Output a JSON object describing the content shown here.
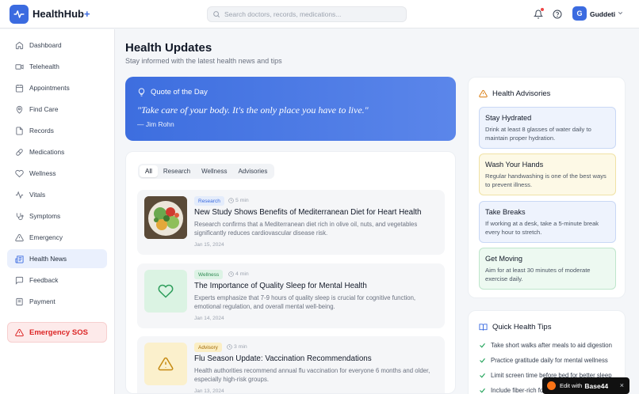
{
  "app": {
    "name": "HealthHub",
    "name_suffix": "+"
  },
  "search": {
    "placeholder": "Search doctors, records, medications..."
  },
  "user": {
    "initial": "G",
    "name": "Guddeti"
  },
  "sidebar": {
    "items": [
      {
        "label": "Dashboard",
        "icon": "home-icon"
      },
      {
        "label": "Telehealth",
        "icon": "video-icon"
      },
      {
        "label": "Appointments",
        "icon": "calendar-icon"
      },
      {
        "label": "Find Care",
        "icon": "map-pin-icon"
      },
      {
        "label": "Records",
        "icon": "file-icon"
      },
      {
        "label": "Medications",
        "icon": "pill-icon"
      },
      {
        "label": "Wellness",
        "icon": "heart-icon"
      },
      {
        "label": "Vitals",
        "icon": "activity-icon"
      },
      {
        "label": "Symptoms",
        "icon": "stethoscope-icon"
      },
      {
        "label": "Emergency",
        "icon": "alert-triangle-icon"
      },
      {
        "label": "Health News",
        "icon": "newspaper-icon",
        "active": true
      },
      {
        "label": "Feedback",
        "icon": "message-icon"
      },
      {
        "label": "Payment",
        "icon": "receipt-icon"
      }
    ],
    "sos_label": "Emergency SOS"
  },
  "main": {
    "title": "Health Updates",
    "subtitle": "Stay informed with the latest health news and tips",
    "quote": {
      "heading": "Quote of the Day",
      "text": "\"Take care of your body. It's the only place you have to live.\"",
      "author": "— Jim Rohn"
    },
    "tabs": [
      {
        "label": "All",
        "active": true
      },
      {
        "label": "Research"
      },
      {
        "label": "Wellness"
      },
      {
        "label": "Advisories"
      }
    ],
    "articles": [
      {
        "category": "Research",
        "read_time": "5 min",
        "title": "New Study Shows Benefits of Mediterranean Diet for Heart Health",
        "description": "Research confirms that a Mediterranean diet rich in olive oil, nuts, and vegetables significantly reduces cardiovascular disease risk.",
        "date": "Jan 15, 2024"
      },
      {
        "category": "Wellness",
        "read_time": "4 min",
        "title": "The Importance of Quality Sleep for Mental Health",
        "description": "Experts emphasize that 7-9 hours of quality sleep is crucial for cognitive function, emotional regulation, and overall mental well-being.",
        "date": "Jan 14, 2024"
      },
      {
        "category": "Advisory",
        "read_time": "3 min",
        "title": "Flu Season Update: Vaccination Recommendations",
        "description": "Health authorities recommend annual flu vaccination for everyone 6 months and older, especially high-risk groups.",
        "date": "Jan 13, 2024"
      }
    ]
  },
  "advisories": {
    "heading": "Health Advisories",
    "items": [
      {
        "title": "Stay Hydrated",
        "text": "Drink at least 8 glasses of water daily to maintain proper hydration.",
        "color": "#eef3fd"
      },
      {
        "title": "Wash Your Hands",
        "text": "Regular handwashing is one of the best ways to prevent illness.",
        "color": "#fdf9e6"
      },
      {
        "title": "Take Breaks",
        "text": "If working at a desk, take a 5-minute break every hour to stretch.",
        "color": "#eef3fd"
      },
      {
        "title": "Get Moving",
        "text": "Aim for at least 30 minutes of moderate exercise daily.",
        "color": "#edf9f1"
      }
    ]
  },
  "tips": {
    "heading": "Quick Health Tips",
    "items": [
      "Take short walks after meals to aid digestion",
      "Practice gratitude daily for mental wellness",
      "Limit screen time before bed for better sleep",
      "Include fiber-rich foods"
    ]
  },
  "edit_badge": {
    "prefix": "Edit with",
    "brand": "Base44",
    "close": "×"
  }
}
